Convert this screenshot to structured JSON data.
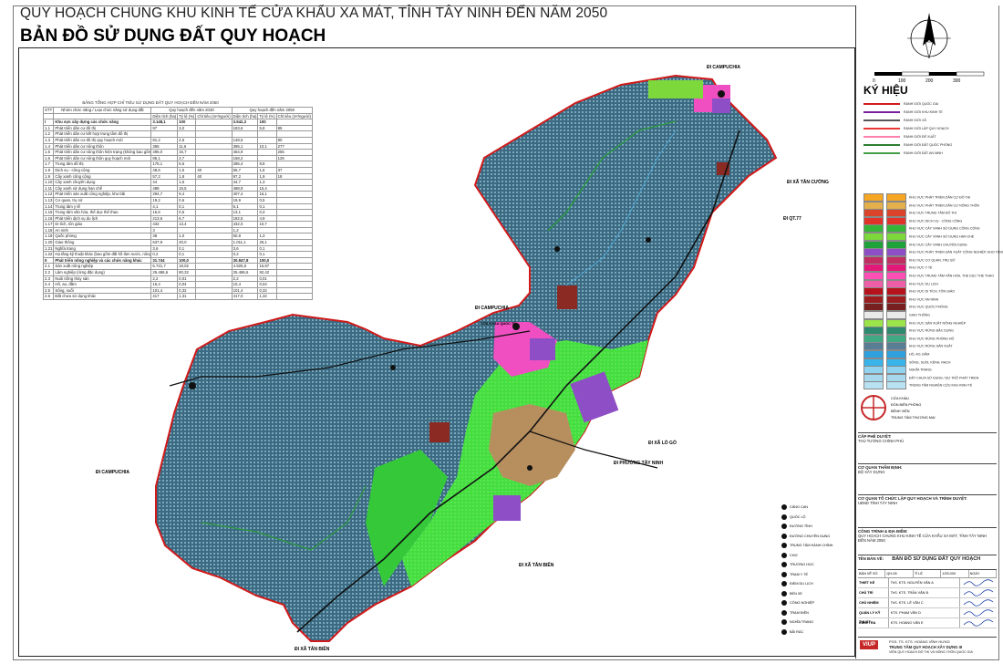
{
  "header": {
    "title": "QUY HOẠCH CHUNG KHU KINH TẾ CỬA KHẨU XA MÁT, TỈNH TÂY NINH ĐẾN NĂM 2050",
    "subtitle": "BẢN ĐỒ SỬ DỤNG ĐẤT QUY HOẠCH"
  },
  "land_table": {
    "caption": "BẢNG TỔNG HỢP CHỈ TIÊU SỬ DỤNG ĐẤT QUY HOẠCH ĐẾN NĂM 2050",
    "headers": [
      "STT",
      "Nhóm chức năng / Loại chức năng sử dụng đất",
      "Quy hoạch đến năm 2030",
      "Quy hoạch đến năm 2050"
    ],
    "subheaders": [
      "Diện tích (ha)",
      "Tỷ lệ (%)",
      "Chỉ tiêu (m²/người)",
      "Diện tích (ha)",
      "Tỷ lệ (%)",
      "Chỉ tiêu (m²/người)"
    ],
    "rows": [
      [
        "I",
        "Khu vực xây dựng các chức năng",
        "3.148,1",
        "100",
        "",
        "3.542,3",
        "100",
        ""
      ],
      [
        "1.1",
        "Phát triển dân cư đô thị",
        "97",
        "3,0",
        "",
        "183,6",
        "5,8",
        "85"
      ],
      [
        "1.2",
        "Phát triển dân cư kết hợp trung tâm đô thị",
        "",
        "",
        "",
        "",
        "",
        ""
      ],
      [
        "1.3",
        "Phát triển dân cư đô thị quy hoạch mới",
        "81,2",
        "2,6",
        "",
        "148,6",
        "",
        "80"
      ],
      [
        "1.4",
        "Phát triển dân cư nông thôn",
        "365",
        "11,6",
        "",
        "395,1",
        "10,1",
        "277"
      ],
      [
        "1.5",
        "Phát triển dân cư nông thôn hiện trạng (không bao gồm đất công nghiệp, cơ sở kết hợp)",
        "495,0",
        "15,7",
        "",
        "464,9",
        "",
        "255"
      ],
      [
        "1.6",
        "Phát triển dân cư nông thôn quy hoạch mới",
        "85,1",
        "2,7",
        "",
        "158,2",
        "",
        "125"
      ],
      [
        "1.7",
        "Trung tâm đô thị",
        "175,1",
        "5,6",
        "",
        "286,4",
        "8,8",
        ""
      ],
      [
        "1.8",
        "Dịch vụ - công cộng",
        "48,6",
        "1,5",
        "40",
        "55,7",
        "1,6",
        "37"
      ],
      [
        "1.9",
        "Cây xanh công cộng",
        "57,2",
        "1,8",
        "40",
        "97,2",
        "1,9",
        "18"
      ],
      [
        "1.10",
        "Cây xanh chuyên dụng",
        "44",
        "1,5",
        "",
        "44,7",
        "1,3",
        ""
      ],
      [
        "1.11",
        "Cây xanh sử dụng hạn chế",
        "488",
        "15,5",
        "",
        "488,9",
        "15,4",
        ""
      ],
      [
        "1.12",
        "Phát triển sản xuất công nghiệp, kho bãi",
        "294,7",
        "9,4",
        "",
        "407,4",
        "16,1",
        ""
      ],
      [
        "1.13",
        "Cơ quan, trụ sở",
        "19,2",
        "0,6",
        "",
        "19,9",
        "0,5",
        ""
      ],
      [
        "1.14",
        "Trung tâm y tế",
        "4,1",
        "0,1",
        "",
        "6,1",
        "0,1",
        ""
      ],
      [
        "1.15",
        "Trung tâm văn hóa, thể dục thể thao",
        "15,6",
        "0,5",
        "",
        "13,1",
        "0,3",
        ""
      ],
      [
        "1.16",
        "Phát triển dịch vụ du lịch",
        "213,6",
        "6,7",
        "",
        "182,5",
        "4,9",
        ""
      ],
      [
        "1.17",
        "Di tích, tôn giáo",
        "432",
        "13,4",
        "",
        "432,0",
        "10,7",
        ""
      ],
      [
        "1.18",
        "An ninh",
        "3",
        "",
        "",
        "1,2",
        "",
        ""
      ],
      [
        "1.19",
        "Quốc phòng",
        "38",
        "1,0",
        "",
        "50,8",
        "1,3",
        ""
      ],
      [
        "1.20",
        "Giao thông",
        "637,9",
        "20,0",
        "",
        "1.011,1",
        "25,1",
        ""
      ],
      [
        "1.21",
        "Nghĩa trang",
        "3,6",
        "0,1",
        "",
        "3,6",
        "0,1",
        ""
      ],
      [
        "1.22",
        "Hạ tầng kỹ thuật khác (bao gồm đất hồ làm nước, nông sản, TT DVCK)",
        "0,2",
        "0,1",
        "",
        "0,2",
        "0,1",
        ""
      ],
      [
        "II",
        "Phát triển nông nghiệp và các chức năng khác",
        "31.744",
        "100,0",
        "",
        "30.847,8",
        "100,0",
        ""
      ],
      [
        "2.1",
        "Sản xuất nông nghiệp",
        "5.721,7",
        "18,02",
        "",
        "4.925,8",
        "15,97",
        ""
      ],
      [
        "2.2",
        "Lâm nghiệp (rừng đặc dụng)",
        "25.486,6",
        "80,32",
        "",
        "25.486,6",
        "82,42",
        ""
      ],
      [
        "2.3",
        "Nuôi trồng thủy sản",
        "2,2",
        "0,01",
        "",
        "2,2",
        "0,01",
        ""
      ],
      [
        "2.4",
        "Hồ, ao, đầm",
        "15,4",
        "0,04",
        "",
        "10,4",
        "0,04",
        ""
      ],
      [
        "2.5",
        "Sông, suối",
        "101,4",
        "0,32",
        "",
        "101,4",
        "0,32",
        ""
      ],
      [
        "2.6",
        "Đất chưa sử dụng khác",
        "417",
        "1,31",
        "",
        "417,0",
        "1,32",
        ""
      ]
    ]
  },
  "map_labels": {
    "campuchia_top": "ĐI CAMPUCHIA",
    "campuchia_mid": "ĐI CAMPUCHIA",
    "campuchia_left": "ĐI CAMPUCHIA",
    "tan_cuong": "ĐI XÃ TÂN CƯỜNG",
    "qt_77": "ĐI QT.77",
    "lo_go": "ĐI XÃ LÒ GÒ",
    "tay_ninh": "ĐI PHƯỜNG TÂY NINH",
    "tan_bien": "ĐI XÃ TÂN BIÊN",
    "tan_bien_2": "ĐI XÃ TÂN BIÊN",
    "border_gate": "CỬA KHẨU QUỐC TẾ"
  },
  "map_legend": {
    "items": [
      "CẢNG CẠN",
      "QUỐC LỘ",
      "ĐƯỜNG TỈNH",
      "ĐƯỜNG CHUYÊN DỤNG",
      "TRUNG TÂM HÀNH CHÍNH",
      "CHỢ",
      "TRƯỜNG HỌC",
      "TRẠM Y TẾ",
      "ĐIỂM DU LỊCH",
      "BẾN XE",
      "CÔNG NGHIỆP",
      "TRẠM ĐIỆN",
      "NGHĨA TRANG",
      "BÃI RÁC"
    ]
  },
  "sidebar": {
    "scale_ticks": [
      "0",
      "100",
      "200",
      "300"
    ],
    "legend_title": "KÝ HIỆU",
    "line_legend": [
      {
        "label": "RANH GIỚI QUỐC GIA",
        "color": "#d11a1a"
      },
      {
        "label": "RANH GIỚI KHU KINH TẾ",
        "color": "#7b1fa2"
      },
      {
        "label": "RANH GIỚI XÃ",
        "color": "#555555"
      },
      {
        "label": "RANH GIỚI LẬP QUY HOẠCH",
        "color": "#e53935"
      },
      {
        "label": "RANH GIỚI ĐỀ XUẤT",
        "color": "#ff80ab"
      },
      {
        "label": "RANH GIỚI ĐẤT QUỐC PHÒNG",
        "color": "#2e7d32"
      },
      {
        "label": "RANH GIỚI ĐẤT AN NINH",
        "color": "#43a047"
      }
    ],
    "legend": [
      {
        "label": "KHU VỰC PHÁT TRIỂN DÂN CƯ ĐÔ THỊ",
        "color": "#f6a623"
      },
      {
        "label": "KHU VỰC PHÁT TRIỂN DÂN CƯ NÔNG THÔN",
        "color": "#e3b04b"
      },
      {
        "label": "KHU VỰC TRUNG TÂM ĐÔ THỊ",
        "color": "#d9442a"
      },
      {
        "label": "KHU VỰC DỊCH VỤ - CÔNG CỘNG",
        "color": "#e2332b"
      },
      {
        "label": "KHU VỰC CÂY XANH SỬ DỤNG CÔNG CỘNG",
        "color": "#35b43a"
      },
      {
        "label": "KHU VỰC CÂY XANH SỬ DỤNG HẠN CHẾ",
        "color": "#7cd83b"
      },
      {
        "label": "KHU VỰC CÂY XANH CHUYÊN DỤNG",
        "color": "#1fa23a"
      },
      {
        "label": "KHU VỰC PHÁT TRIỂN SẢN XUẤT CÔNG NGHIỆP, KHO TÀNG",
        "color": "#8e4fc6"
      },
      {
        "label": "KHU VỰC CƠ QUAN, TRỤ SỞ",
        "color": "#c22e62"
      },
      {
        "label": "KHU VỰC Y TẾ",
        "color": "#e3197a"
      },
      {
        "label": "KHU VỰC TRUNG TÂM VĂN HÓA, THỂ DỤC THỂ THAO",
        "color": "#ff4fb6"
      },
      {
        "label": "KHU VỰC DU LỊCH",
        "color": "#ef5fa7"
      },
      {
        "label": "KHU VỰC DI TÍCH, TÔN GIÁO",
        "color": "#b5121b"
      },
      {
        "label": "KHU VỰC AN NINH",
        "color": "#9b1d20"
      },
      {
        "label": "KHU VỰC QUỐC PHÒNG",
        "color": "#76211f"
      },
      {
        "label": "GIAO THÔNG",
        "color": "#e9e9e9"
      },
      {
        "label": "KHU VỰC SẢN XUẤT NÔNG NGHIỆP",
        "color": "#9be44a"
      },
      {
        "label": "KHU VỰC RỪNG ĐẶC DỤNG",
        "color": "#2e8a6e"
      },
      {
        "label": "KHU VỰC RỪNG PHÒNG HỘ",
        "color": "#41a884"
      },
      {
        "label": "KHU VỰC RỪNG SẢN XUẤT",
        "color": "#5a7d96"
      },
      {
        "label": "HỒ, AO, ĐẦM",
        "color": "#2fa0de"
      },
      {
        "label": "SÔNG, SUỐI, KÊNH, RẠCH",
        "color": "#39b4ea"
      },
      {
        "label": "NGHĨA TRANG",
        "color": "#8fd3f0"
      },
      {
        "label": "ĐẤT CHƯA SỬ DỤNG / DỰ TRỮ PHÁT TRIỂN",
        "color": "#a7d8ee"
      },
      {
        "label": "TRUNG TÂM NGHIÊN CỨU KHU KINH TẾ",
        "color": "#b8e1f2"
      }
    ],
    "symbol_legend": [
      "CỬA KHẨU",
      "ĐỒN BIÊN PHÒNG",
      "BỆNH VIỆN",
      "TRUNG TÂM THƯƠNG MẠI"
    ],
    "approval": {
      "label": "CẤP PHÊ DUYỆT:",
      "value": "THỦ TƯỚNG CHÍNH PHỦ"
    },
    "appraisal": {
      "label": "CƠ QUAN THẨM ĐỊNH:",
      "value": "BỘ XÂY DỰNG"
    },
    "organizer": {
      "label": "CƠ QUAN TỔ CHỨC LẬP QUY HOẠCH VÀ TRÌNH DUYỆT:",
      "value": "UBND TỈNH TÂY NINH"
    },
    "project": {
      "label": "CÔNG TRÌNH & ĐỊA ĐIỂM:",
      "value": "QUY HOẠCH CHUNG KHU KINH TẾ CỬA KHẨU XA MÁT, TỈNH TÂY NINH ĐẾN NĂM 2050"
    },
    "drawing": {
      "label": "TÊN BẢN VẼ:",
      "value": "BẢN ĐỒ SỬ DỤNG ĐẤT QUY HOẠCH"
    },
    "signoff_header": [
      "BẢN VẼ SỐ",
      "QH-05",
      "TỈ LỆ",
      "1/25.000",
      "NGÀY"
    ],
    "signoff_roles": [
      "THIẾT KẾ",
      "CHỦ TRÌ",
      "CHỦ NHIỆM",
      "QUẢN LÝ KỸ THUẬT",
      "KIỂM TRA"
    ],
    "signoff_names": [
      "ThS. KTS. NGUYỄN VĂN A",
      "ThS. KTS. TRẦN VĂN B",
      "ThS. KTS. LÊ VĂN C",
      "KTS. PHẠM VĂN D",
      "KTS. HOÀNG VĂN E"
    ],
    "director": "PGS. TS. KTS. HOÀNG VĨNH HƯNG",
    "company_logo": "VIUP",
    "company": "TRUNG TÂM QUY HOẠCH XÂY DỰNG III",
    "company_sub": "VIỆN QUY HOẠCH ĐÔ THỊ VÀ NÔNG THÔN QUỐC GIA"
  },
  "colors": {
    "forest": "#3d6e86",
    "forest_dot": "#9fd0e2",
    "boundary": "#d11a1a",
    "agri": "#46e34a",
    "urban": "#b38b5c",
    "industry": "#8e4fc6",
    "tourism": "#ef4fc0"
  }
}
